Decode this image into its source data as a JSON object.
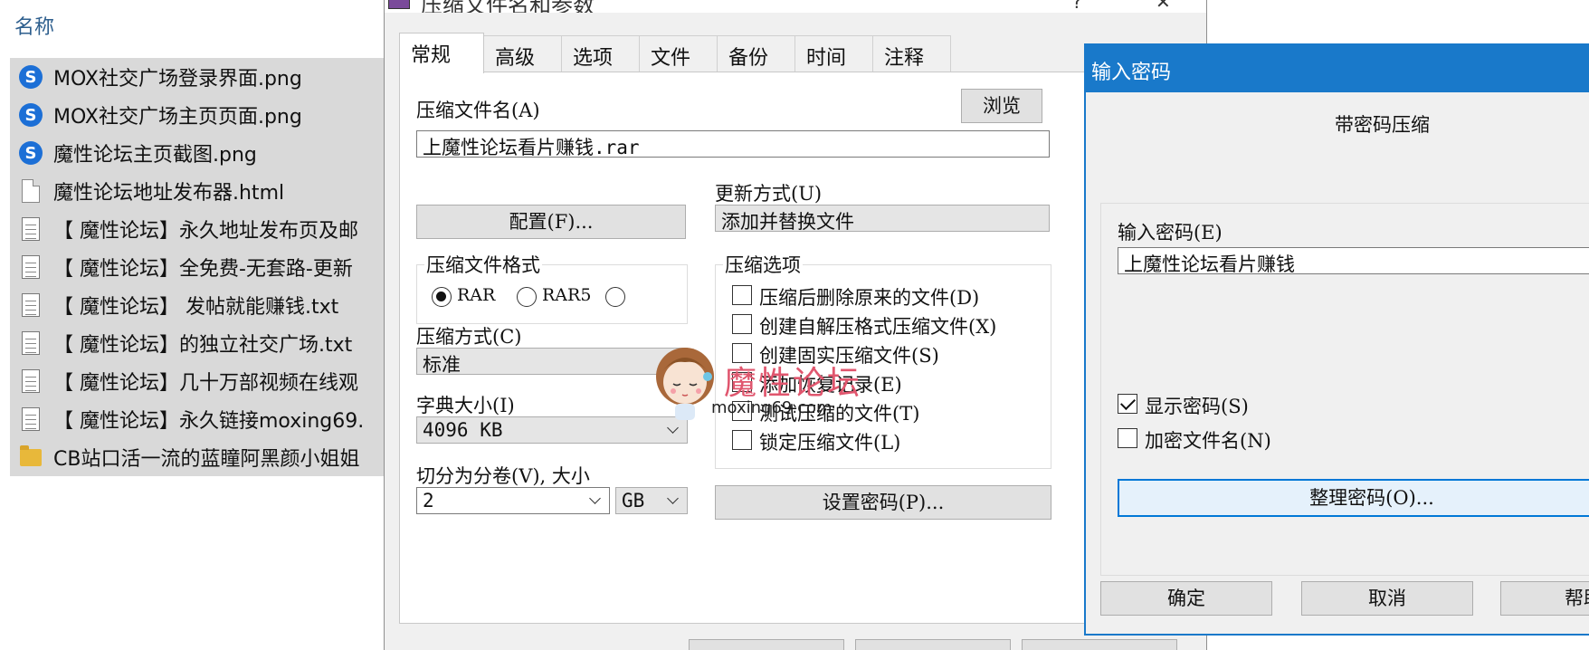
{
  "explorer": {
    "column_header": "名称",
    "files": [
      {
        "name": "MOX社交广场登录界面.png",
        "icon": "image-png-icon"
      },
      {
        "name": "MOX社交广场主页页面.png",
        "icon": "image-png-icon"
      },
      {
        "name": "魔性论坛主页截图.png",
        "icon": "image-png-icon"
      },
      {
        "name": "魔性论坛地址发布器.html",
        "icon": "html-file-icon"
      },
      {
        "name": "【 魔性论坛】永久地址发布页及邮",
        "icon": "text-file-icon"
      },
      {
        "name": "【 魔性论坛】全免费-无套路-更新",
        "icon": "text-file-icon"
      },
      {
        "name": "【 魔性论坛】 发帖就能赚钱.txt",
        "icon": "text-file-icon"
      },
      {
        "name": "【 魔性论坛】的独立社交广场.txt",
        "icon": "text-file-icon"
      },
      {
        "name": "【 魔性论坛】几十万部视频在线观",
        "icon": "text-file-icon"
      },
      {
        "name": "【 魔性论坛】永久链接moxing69.",
        "icon": "text-file-icon"
      },
      {
        "name": "CB站口活一流的蓝瞳阿黑颜小姐姐",
        "icon": "folder-icon"
      }
    ]
  },
  "archive": {
    "title": "压缩文件名和参数",
    "tabs": [
      "常规",
      "高级",
      "选项",
      "文件",
      "备份",
      "时间",
      "注释"
    ],
    "active_tab": 0,
    "archive_name_label": "压缩文件名(A)",
    "archive_name_value": "上魔性论坛看片赚钱.rar",
    "browse_label": "浏览",
    "update_mode_label": "更新方式(U)",
    "update_mode_value": "添加并替换文件",
    "profiles_label": "配置(F)...",
    "format_group_label": "压缩文件格式",
    "formats": [
      {
        "label": "RAR",
        "selected": true
      },
      {
        "label": "RAR5",
        "selected": false
      },
      {
        "label": "",
        "selected": false
      }
    ],
    "options_group_label": "压缩选项",
    "options": [
      {
        "label": "压缩后删除原来的文件(D)",
        "checked": false
      },
      {
        "label": "创建自解压格式压缩文件(X)",
        "checked": false
      },
      {
        "label": "创建固实压缩文件(S)",
        "checked": false
      },
      {
        "label": "添加恢复记录(E)",
        "checked": false
      },
      {
        "label": "测试压缩的文件(T)",
        "checked": false
      },
      {
        "label": "锁定压缩文件(L)",
        "checked": false
      }
    ],
    "method_label": "压缩方式(C)",
    "method_value": "标准",
    "dict_label": "字典大小(I)",
    "dict_value": "4096 KB",
    "split_label": "切分为分卷(V), 大小",
    "split_value": "2",
    "split_unit": "GB",
    "set_password_label": "设置密码(P)..."
  },
  "watermark": {
    "text": "魔性论坛",
    "url": "moxing69.com"
  },
  "password_dialog": {
    "title": "输入密码",
    "heading": "带密码压缩",
    "input_label": "输入密码(E)",
    "input_value": "上魔性论坛看片赚钱",
    "show_password_label": "显示密码(S)",
    "show_password_checked": true,
    "encrypt_names_label": "加密文件名(N)",
    "encrypt_names_checked": false,
    "organize_label": "整理密码(O)...",
    "ok_label": "确定",
    "cancel_label": "取消",
    "help_label": "帮助"
  },
  "colors": {
    "accent": "#1979ca",
    "selection": "#d9d9d9",
    "dialog_bg": "#f0f0f0",
    "watermark": "#e0566e"
  }
}
